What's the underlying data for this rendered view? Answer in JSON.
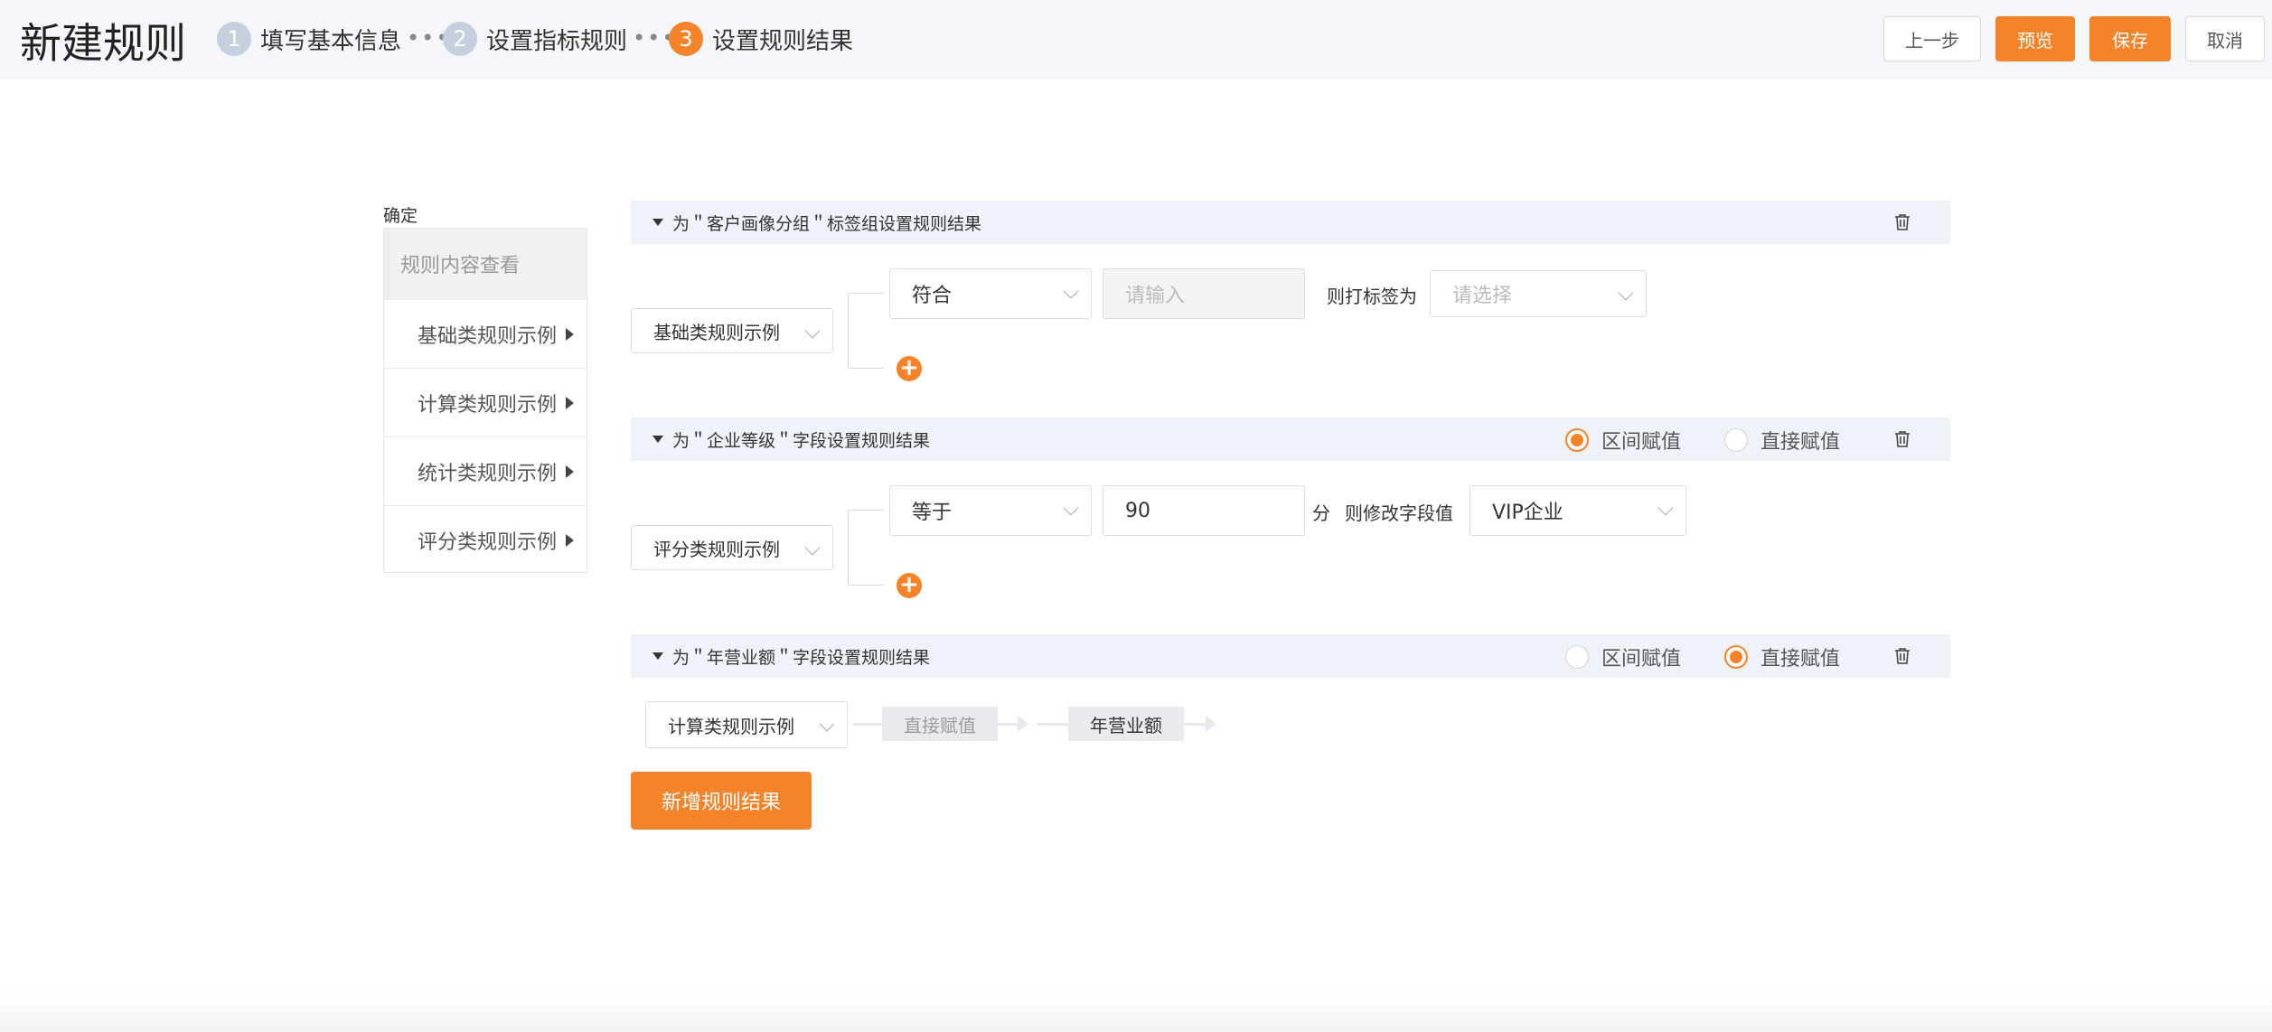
{
  "header": {
    "title": "新建规则",
    "steps": [
      {
        "num": "1",
        "label": "填写基本信息"
      },
      {
        "num": "2",
        "label": "设置指标规则"
      },
      {
        "num": "3",
        "label": "设置规则结果"
      }
    ],
    "dots": "•••",
    "buttons": {
      "prev": "上一步",
      "preview": "预览",
      "save": "保存",
      "cancel": "取消"
    }
  },
  "sidebar": {
    "confirm_label": "确定",
    "head": "规则内容查看",
    "items": [
      "基础类规则示例",
      "计算类规则示例",
      "统计类规则示例",
      "评分类规则示例"
    ]
  },
  "sections": [
    {
      "title": "为＂客户画像分组＂标签组设置规则结果",
      "rule_select": "基础类规则示例",
      "condition": "符合",
      "input_placeholder": "请输入",
      "then_label": "则打标签为",
      "target_placeholder": "请选择"
    },
    {
      "title": "为＂企业等级＂字段设置规则结果",
      "radio_range": "区间赋值",
      "radio_direct": "直接赋值",
      "selected": "区间赋值",
      "rule_select": "评分类规则示例",
      "condition": "等于",
      "input_value": "90",
      "unit": "分",
      "then_label": "则修改字段值",
      "target_value": "VIP企业"
    },
    {
      "title": "为＂年营业额＂字段设置规则结果",
      "radio_range": "区间赋值",
      "radio_direct": "直接赋值",
      "selected": "直接赋值",
      "rule_select": "计算类规则示例",
      "flow_step": "直接赋值",
      "flow_target": "年营业额"
    }
  ],
  "add_button": "新增规则结果",
  "colors": {
    "accent": "#f5832a",
    "section_bg": "#eef2f9",
    "step_inactive": "#c6cfdd"
  }
}
